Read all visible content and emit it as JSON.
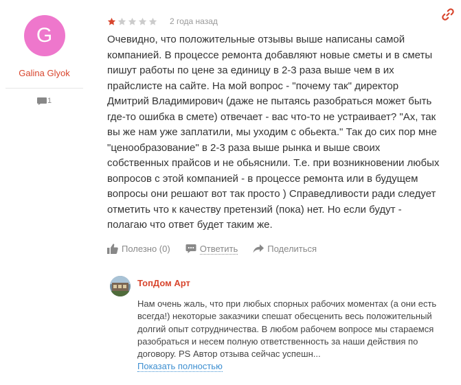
{
  "author": {
    "avatar_letter": "G",
    "avatar_color": "#ee77cc",
    "name": "Galina Glyok",
    "reviews_count": "1",
    "count_icon": "speech-bubble-icon"
  },
  "review": {
    "rating": 1,
    "max_rating": 5,
    "star_filled_color": "#d8462e",
    "star_empty_color": "#cccccc",
    "date": "2 года назад",
    "link_icon": "link-icon",
    "link_color": "#d8462e",
    "text": "Очевидно, что положительные отзывы выше написаны самой компанией. В процессе ремонта добавляют новые сметы и в сметы пишут работы по цене за единицу в 2-3 раза выше чем в их прайслисте на сайте. На мой вопрос - \"почему так\" директор Дмитрий Владимирович (даже не пытаясь разобраться может быть где-то ошибка в смете) отвечает - вас что-то не устраивает? \"Ах, так вы же нам уже заплатили, мы уходим с обьекта.\" Так до сих пор мне \"ценообразование\" в 2-3 раза выше рынка и выше своих собственных прайсов и не обьяснили. Т.е. при возникновении любых вопросов с этой компанией - в процессе ремонта или в будущем вопросы они решают вот так просто ) Справедливости ради следует отметить что к качеству претензий (пока) нет. Но если будут - полагаю что ответ будет таким же."
  },
  "actions": {
    "useful_label": "Полезно (0)",
    "reply_label": "Ответить",
    "share_label": "Поделиться"
  },
  "response": {
    "company_name": "ТопДом Арт",
    "text": "Нам очень жаль, что при любых спорных рабочих моментах (а они есть всегда!) некоторые заказчики спешат обесценить весь положительный долгий опыт сотрудничества. В любом рабочем вопросе мы стараемся разобраться и несем полную ответственность за наши действия по договору. PS Автор отзыва сейчас успешн...",
    "show_more_label": "Показать полностью"
  }
}
